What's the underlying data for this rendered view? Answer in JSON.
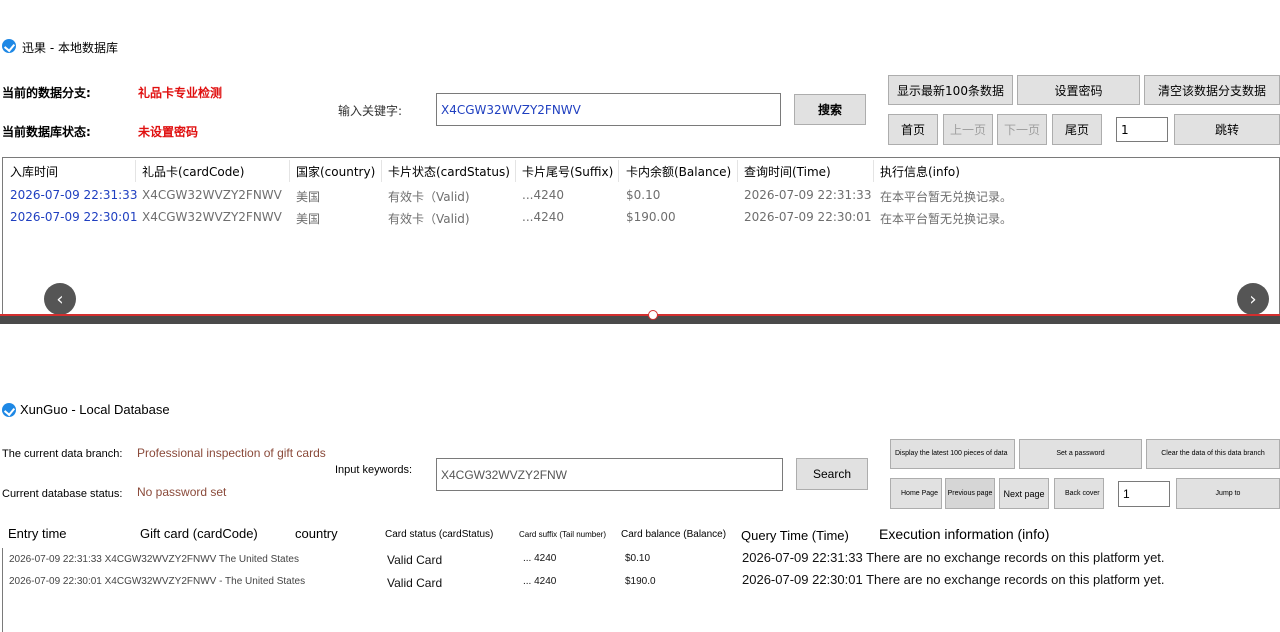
{
  "top": {
    "window_title": "迅果 - 本地数据库",
    "branch_label": "当前的数据分支:",
    "branch_value": "礼品卡专业检测",
    "status_label": "当前数据库状态:",
    "status_value": "未设置密码",
    "keyword_label": "输入关键字:",
    "keyword_value": "X4CGW32WVZY2FNWV",
    "search_label": "搜索",
    "btn_latest": "显示最新100条数据",
    "btn_password": "设置密码",
    "btn_clear": "清空该数据分支数据",
    "btn_first": "首页",
    "btn_prev": "上一页",
    "btn_next": "下一页",
    "btn_last": "尾页",
    "page_value": "1",
    "btn_jump": "跳转",
    "columns": [
      "入库时间",
      "礼品卡(cardCode)",
      "国家(country)",
      "卡片状态(cardStatus)",
      "卡片尾号(Suffix)",
      "卡内余额(Balance)",
      "查询时间(Time)",
      "执行信息(info)"
    ],
    "rows": [
      [
        "2026-07-09 22:31:33",
        "X4CGW32WVZY2FNWV",
        "美国",
        "有效卡（Valid)",
        "...4240",
        "$0.10",
        "2026-07-09 22:31:33",
        "在本平台暂无兑换记录。"
      ],
      [
        "2026-07-09 22:30:01",
        "X4CGW32WVZY2FNWV",
        "美国",
        "有效卡（Valid)",
        "...4240",
        "$190.00",
        "2026-07-09 22:30:01",
        "在本平台暂无兑换记录。"
      ]
    ]
  },
  "icons": {
    "prev": "chevron-left-icon",
    "next": "chevron-right-icon",
    "app": "app-logo-icon",
    "accent": "#1e88e5"
  },
  "nav": {
    "prev_glyph": "‹",
    "next_glyph": "›"
  },
  "bottom": {
    "window_title": "XunGuo - Local Database",
    "branch_label": "The current data branch:",
    "branch_value": "Professional inspection of gift cards",
    "status_label": "Current database status:",
    "status_value": "No password set",
    "keyword_label": "Input keywords:",
    "keyword_value": "X4CGW32WVZY2FNW",
    "search_label": "Search",
    "btn_latest": "Display the latest 100 pieces of data",
    "btn_password": "Set a password",
    "btn_clear": "Clear the data of this data branch",
    "btn_first": "Home Page",
    "btn_prev": "Previous page",
    "btn_next": "Next page",
    "btn_last": "Back cover",
    "page_value": "1",
    "btn_jump": "Jump to",
    "columns": [
      "Entry time",
      "Gift card (cardCode)",
      "country",
      "Card status (cardStatus)",
      "Card suffix (Tail number)",
      "Card balance (Balance)",
      "Query Time (Time)",
      "Execution information (info)"
    ],
    "rows": [
      [
        "2026-07-09 22:31:33 X4CGW32WVZY2FNWV The United States",
        "Valid Card",
        "... 4240",
        "$0.10",
        "2026-07-09 22:31:33 There are no exchange records on this platform yet."
      ],
      [
        "2026-07-09 22:30:01 X4CGW32WVZY2FNWV - The United States",
        "Valid Card",
        "... 4240",
        "$190.0",
        "2026-07-09 22:30:01 There are no exchange records on this platform yet."
      ]
    ]
  }
}
